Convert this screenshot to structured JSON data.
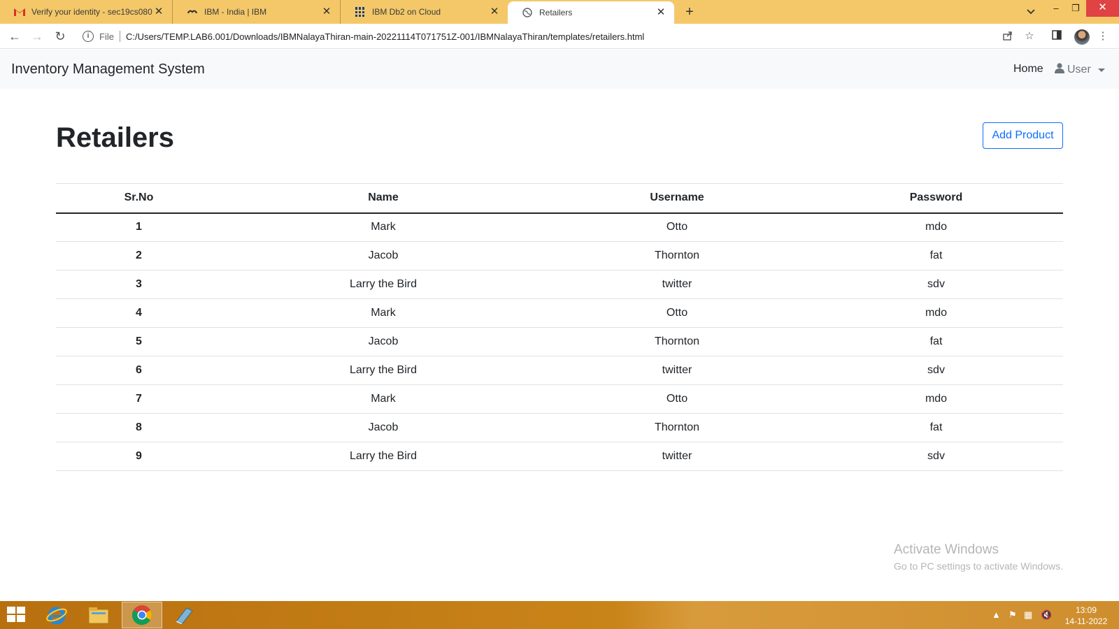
{
  "browser": {
    "tabs": [
      {
        "title": "Verify your identity - sec19cs080",
        "icon": "gmail-icon"
      },
      {
        "title": "IBM - India | IBM",
        "icon": "ibm-icon"
      },
      {
        "title": "IBM Db2 on Cloud",
        "icon": "db2-icon"
      },
      {
        "title": "Retailers",
        "icon": "globe-icon"
      }
    ],
    "address": {
      "scheme": "File",
      "url": "C:/Users/TEMP.LAB6.001/Downloads/IBMNalayaThiran-main-20221114T071751Z-001/IBMNalayaThiran/templates/retailers.html"
    }
  },
  "navbar": {
    "brand": "Inventory Management System",
    "home": "Home",
    "user": "User"
  },
  "page": {
    "title": "Retailers",
    "add_button": "Add Product"
  },
  "table": {
    "headers": [
      "Sr.No",
      "Name",
      "Username",
      "Password"
    ],
    "rows": [
      [
        "1",
        "Mark",
        "Otto",
        "mdo"
      ],
      [
        "2",
        "Jacob",
        "Thornton",
        "fat"
      ],
      [
        "3",
        "Larry the Bird",
        "twitter",
        "sdv"
      ],
      [
        "4",
        "Mark",
        "Otto",
        "mdo"
      ],
      [
        "5",
        "Jacob",
        "Thornton",
        "fat"
      ],
      [
        "6",
        "Larry the Bird",
        "twitter",
        "sdv"
      ],
      [
        "7",
        "Mark",
        "Otto",
        "mdo"
      ],
      [
        "8",
        "Jacob",
        "Thornton",
        "fat"
      ],
      [
        "9",
        "Larry the Bird",
        "twitter",
        "sdv"
      ]
    ]
  },
  "watermark": {
    "line1": "Activate Windows",
    "line2": "Go to PC settings to activate Windows."
  },
  "taskbar": {
    "time": "13:09",
    "date": "14-11-2022"
  },
  "colors": {
    "tabstrip": "#f4c869",
    "primary": "#0d6efd",
    "taskbar": "#c98419"
  }
}
